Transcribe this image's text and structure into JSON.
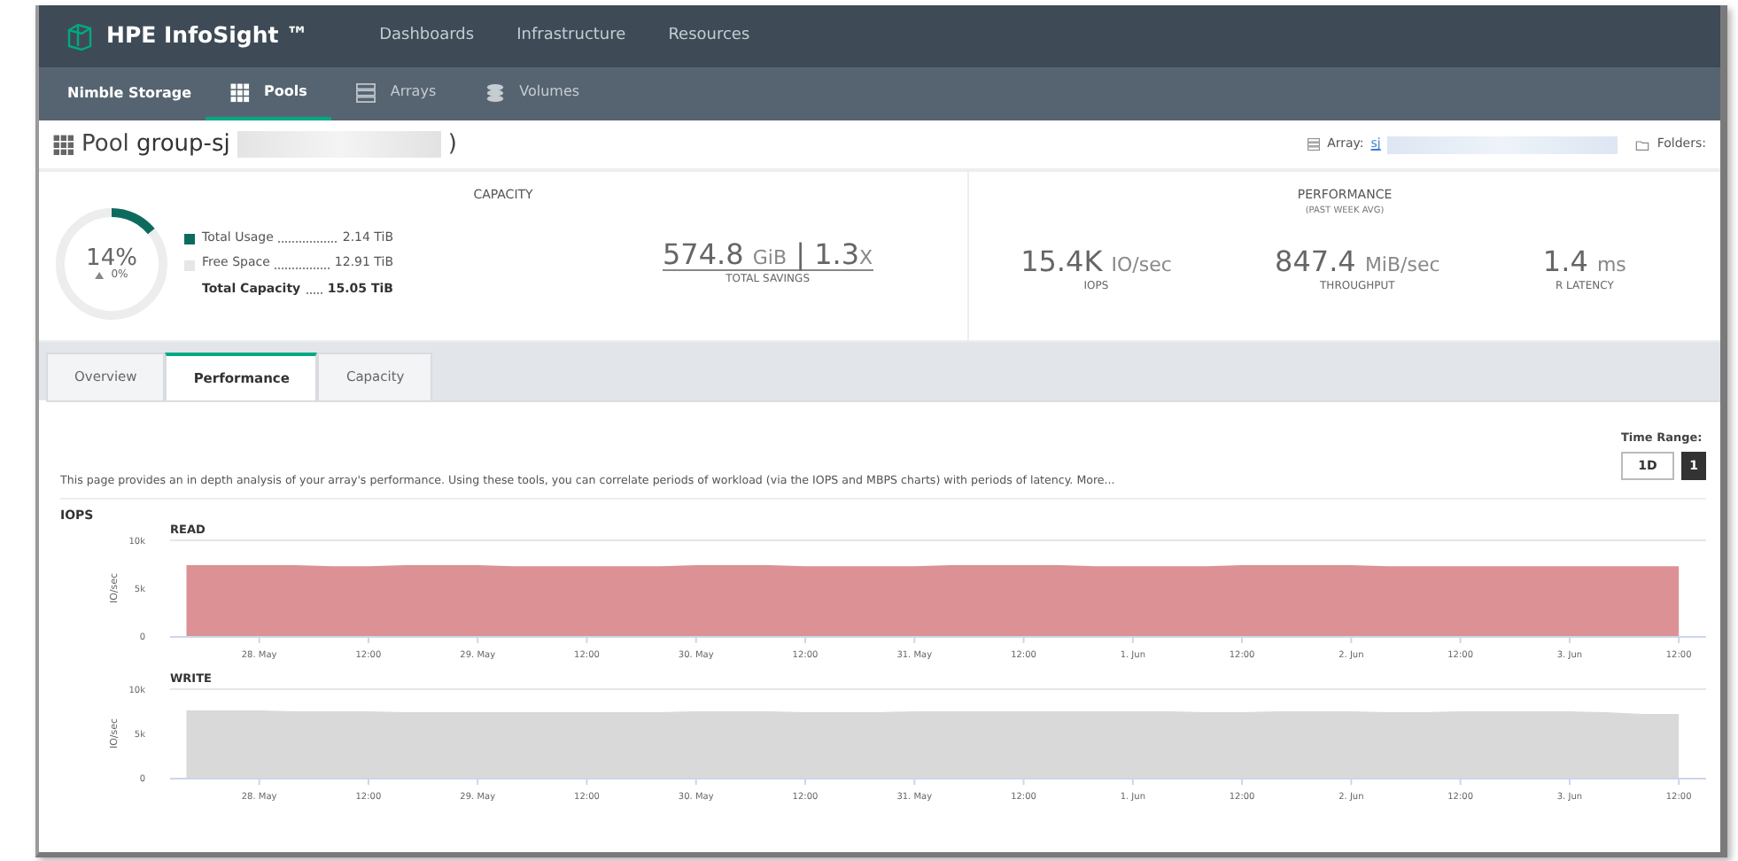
{
  "brand": {
    "name": "HPE InfoSight ™"
  },
  "top_nav": [
    {
      "label": "Dashboards"
    },
    {
      "label": "Infrastructure"
    },
    {
      "label": "Resources"
    }
  ],
  "sub_nav": {
    "title": "Nimble Storage",
    "items": [
      {
        "label": "Pools",
        "kind": "grid",
        "selected": true
      },
      {
        "label": "Arrays",
        "kind": "servers",
        "selected": false
      },
      {
        "label": "Volumes",
        "kind": "database",
        "selected": false
      }
    ]
  },
  "pool": {
    "prefix": "Pool",
    "name": "group-sj",
    "suffix": ")",
    "array_label": "Array:",
    "array_value": "sj",
    "folders_label": "Folders:"
  },
  "capacity": {
    "title": "CAPACITY",
    "percent": "14%",
    "change": "0%",
    "level": 0.14,
    "legend": [
      {
        "label": "Total Usage",
        "value": "2.14 TiB",
        "color": "#0d6b5e",
        "kind": "swatch"
      },
      {
        "label": "Free Space",
        "value": "12.91 TiB",
        "color": "#e6e6e6",
        "kind": "swatch"
      },
      {
        "label": "Total Capacity",
        "value": "15.05 TiB",
        "kind": "total"
      }
    ],
    "savings": {
      "value": "574.8",
      "unit": "GiB",
      "separator": "|",
      "ratio": "1.3",
      "ratio_unit": "X",
      "label": "TOTAL SAVINGS"
    }
  },
  "performance": {
    "title": "PERFORMANCE",
    "subtitle": "(PAST WEEK AVG)",
    "metrics": [
      {
        "value": "15.4K",
        "unit": "IO/sec",
        "label": "IOPS"
      },
      {
        "value": "847.4",
        "unit": "MiB/sec",
        "label": "THROUGHPUT"
      },
      {
        "value": "1.4",
        "unit": "ms",
        "label": "R LATENCY"
      }
    ]
  },
  "tabs": [
    {
      "label": "Overview",
      "selected": false
    },
    {
      "label": "Performance",
      "selected": true
    },
    {
      "label": "Capacity",
      "selected": false
    }
  ],
  "time_range": {
    "label": "Time Range:",
    "options": [
      {
        "label": "1D",
        "selected": false
      },
      {
        "label": "1",
        "selected": true
      }
    ]
  },
  "description": {
    "text": "This page provides an in depth analysis of your array's performance. Using these tools, you can correlate periods of workload (via the IOPS and MBPS charts) with periods of latency.",
    "link": "More..."
  },
  "iops": {
    "title": "IOPS",
    "charts": [
      {
        "chart_data": {
          "type": "area",
          "title": "READ",
          "ylabel": "IO/sec",
          "ylim": [
            0,
            10000
          ],
          "categories": [
            null,
            null,
            "28. May",
            null,
            null,
            "12:00",
            null,
            null,
            "29. May",
            null,
            null,
            "12:00",
            null,
            null,
            "30. May",
            null,
            null,
            "12:00",
            null,
            null,
            "31. May",
            null,
            null,
            "12:00",
            null,
            null,
            "1. Jun",
            null,
            null,
            "12:00",
            null,
            null,
            "2. Jun",
            null,
            null,
            "12:00",
            null,
            null,
            "3. Jun",
            null,
            null,
            "12:00"
          ],
          "series": [
            {
              "color": "#dc9194",
              "values": [
                7400,
                7400,
                7400,
                7400,
                7300,
                7300,
                7400,
                7400,
                7400,
                7300,
                7300,
                7300,
                7300,
                7300,
                7400,
                7400,
                7400,
                7300,
                7300,
                7300,
                7300,
                7400,
                7400,
                7400,
                7400,
                7300,
                7300,
                7300,
                7300,
                7400,
                7400,
                7400,
                7400,
                7300,
                7300,
                7300,
                7300,
                7300,
                7300,
                7300,
                7300,
                7300
              ]
            }
          ],
          "yticks": [
            {
              "value": 0,
              "label": "0"
            },
            {
              "value": 5000,
              "label": "5k"
            },
            {
              "value": 10000,
              "label": "10k"
            }
          ]
        }
      },
      {
        "chart_data": {
          "type": "area",
          "title": "WRITE",
          "ylabel": "IO/sec",
          "ylim": [
            0,
            10000
          ],
          "categories": [
            null,
            null,
            "28. May",
            null,
            null,
            "12:00",
            null,
            null,
            "29. May",
            null,
            null,
            "12:00",
            null,
            null,
            "30. May",
            null,
            null,
            "12:00",
            null,
            null,
            "31. May",
            null,
            null,
            "12:00",
            null,
            null,
            "1. Jun",
            null,
            null,
            "12:00",
            null,
            null,
            "2. Jun",
            null,
            null,
            "12:00",
            null,
            null,
            "3. Jun",
            null,
            null,
            "12:00"
          ],
          "series": [
            {
              "color": "#d9d9d9",
              "values": [
                7600,
                7600,
                7600,
                7500,
                7500,
                7500,
                7400,
                7400,
                7400,
                7400,
                7400,
                7400,
                7400,
                7400,
                7500,
                7500,
                7500,
                7400,
                7400,
                7400,
                7500,
                7500,
                7500,
                7500,
                7500,
                7500,
                7500,
                7500,
                7400,
                7400,
                7500,
                7500,
                7500,
                7400,
                7400,
                7500,
                7500,
                7500,
                7500,
                7400,
                7200,
                7200
              ]
            }
          ],
          "yticks": [
            {
              "value": 0,
              "label": "0"
            },
            {
              "value": 5000,
              "label": "5k"
            },
            {
              "value": 10000,
              "label": "10k"
            }
          ]
        }
      }
    ]
  }
}
